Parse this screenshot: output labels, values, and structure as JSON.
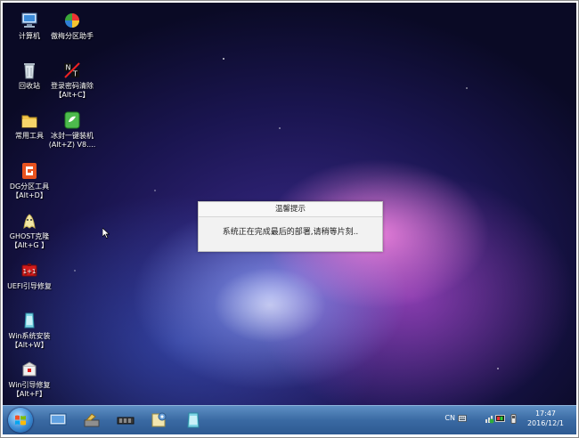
{
  "desktop_icons": [
    {
      "name": "computer",
      "label": "计算机"
    },
    {
      "name": "partition-assistant",
      "label": "傲梅分区助手"
    },
    {
      "name": "recycle-bin",
      "label": "回收站"
    },
    {
      "name": "password-clear",
      "label": "登录密码清除\n【Alt+C】"
    },
    {
      "name": "common-tools",
      "label": "常用工具"
    },
    {
      "name": "bingfeng-install",
      "label": "冰封一键装机\n(Alt+Z) V8...."
    },
    {
      "name": "dg-partition",
      "label": "DG分区工具\n【Alt+D】"
    },
    {
      "name": "ghost",
      "label": "GHOST克隆\n【Alt+G 】"
    },
    {
      "name": "uefi-repair",
      "label": "UEFI引导修复"
    },
    {
      "name": "win-install",
      "label": "Win系统安装\n【Alt+W】"
    },
    {
      "name": "win-boot-repair",
      "label": "Win引导修复\n【Alt+F】"
    }
  ],
  "dialog": {
    "title": "温馨提示",
    "message": "系统正在完成最后的部署,请稍等片刻.."
  },
  "taskbar": {
    "language": "CN",
    "time": "17:47",
    "date": "2016/12/1"
  }
}
